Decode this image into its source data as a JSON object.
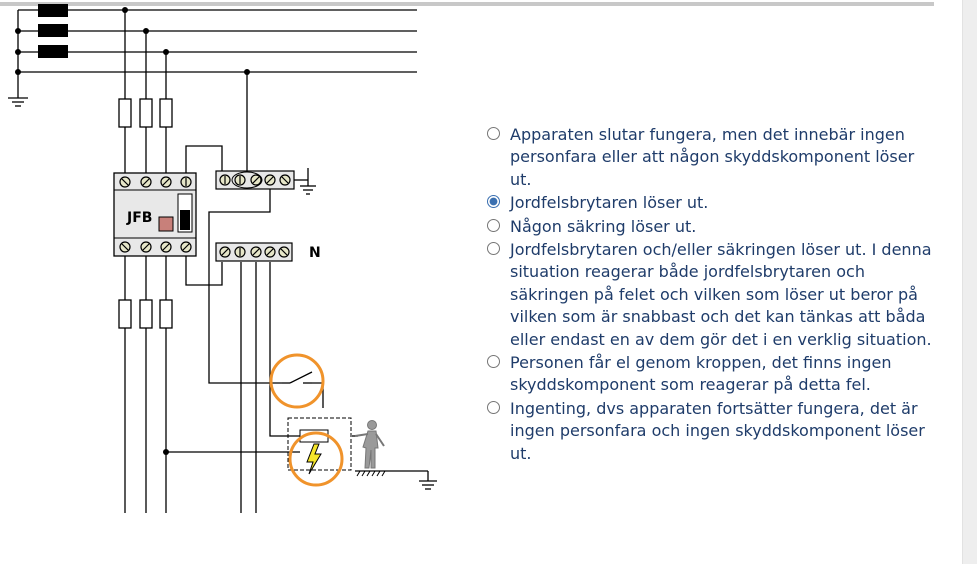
{
  "diagram": {
    "jfb_label": "JFB",
    "neutral_label": "N"
  },
  "question": {
    "selected_index": 1,
    "options": [
      {
        "label": "Apparaten slutar fungera, men det innebär ingen personfara eller att någon skyddskomponent löser ut."
      },
      {
        "label": "Jordfelsbrytaren löser ut."
      },
      {
        "label": "Någon säkring löser ut."
      },
      {
        "label": "Jordfelsbrytaren och/eller säkringen löser ut. I denna situation reagerar både jordfelsbrytaren och säkringen på felet och vilken som löser ut beror på vilken som är snabbast och det kan tänkas att båda eller endast en av dem gör det i en verklig situation."
      },
      {
        "label": "Personen får el genom kroppen, det finns ingen skyddskomponent som reagerar på detta fel."
      },
      {
        "label": "Ingenting, dvs apparaten fortsätter fungera, det är ingen personfara och ingen skyddskomponent löser ut."
      }
    ]
  },
  "colors": {
    "answer_text": "#1f3c6a",
    "highlight_circle": "#f0932b",
    "lightning": "#f5e52a"
  }
}
